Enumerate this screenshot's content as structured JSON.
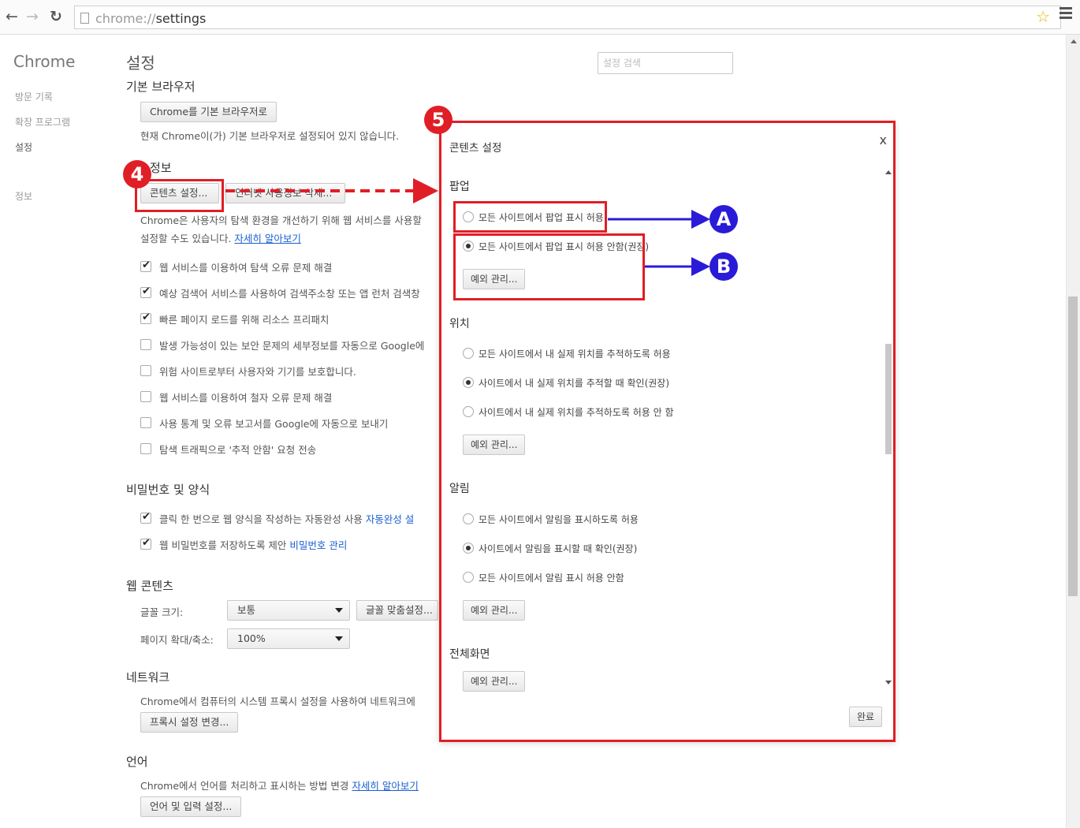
{
  "toolbar": {
    "back_icon": "back-arrow-icon",
    "forward_icon": "forward-arrow-icon",
    "reload_icon": "reload-icon",
    "url_scheme": "chrome://",
    "url_path": "settings",
    "star_icon": "star-icon",
    "menu_icon": "hamburger-menu-icon"
  },
  "sidebar": {
    "brand": "Chrome",
    "items": [
      {
        "label": "방문 기록"
      },
      {
        "label": "확장 프로그램"
      },
      {
        "label": "설정"
      },
      {
        "label": "정보"
      }
    ]
  },
  "settings": {
    "title": "설정",
    "search_placeholder": "설정 검색",
    "default_browser": {
      "heading": "기본 브라우저",
      "button": "Chrome를 기본 브라우저로",
      "status": "현재 Chrome이(가) 기본 브라우저로 설정되어 있지 않습니다."
    },
    "privacy": {
      "heading": "정보",
      "content_settings_button": "콘텐츠 설정...",
      "clear_data_button": "인터넷 사용정보 삭제...",
      "desc_line1": "Chrome은 사용자의 탐색 환경을 개선하기 위해 웹 서비스를 사용할",
      "desc_line2": "설정할 수도 있습니다.",
      "learn_more": "자세히 알아보기",
      "checkboxes": [
        {
          "label": "웹 서비스를 이용하여 탐색 오류 문제 해결",
          "checked": true
        },
        {
          "label": "예상 검색어 서비스를 사용하여 검색주소창 또는 앱 런처 검색창",
          "checked": true
        },
        {
          "label": "빠른 페이지 로드를 위해 리소스 프리패치",
          "checked": true
        },
        {
          "label": "발생 가능성이 있는 보안 문제의 세부정보를 자동으로 Google에",
          "checked": false
        },
        {
          "label": "위험 사이트로부터 사용자와 기기를 보호합니다.",
          "checked": false
        },
        {
          "label": "웹 서비스를 이용하여 철자 오류 문제 해결",
          "checked": false
        },
        {
          "label": "사용 통계 및 오류 보고서를 Google에 자동으로 보내기",
          "checked": false
        },
        {
          "label": "탐색 트래픽으로 '추적 안함' 요청 전송",
          "checked": false
        }
      ]
    },
    "passwords": {
      "heading": "비밀번호 및 양식",
      "autofill_label": "클릭 한 번으로 웹 양식을 작성하는 자동완성 사용",
      "autofill_link": "자동완성 설",
      "password_label": "웹 비밀번호를 저장하도록 제안",
      "password_link": "비밀번호 관리"
    },
    "web_content": {
      "heading": "웹 콘텐츠",
      "font_size_label": "글꼴 크기:",
      "font_size_value": "보통",
      "customize_fonts_button": "글꼴 맞춤설정...",
      "zoom_label": "페이지 확대/축소:",
      "zoom_value": "100%"
    },
    "network": {
      "heading": "네트워크",
      "desc": "Chrome에서 컴퓨터의 시스템 프록시 설정을 사용하여 네트워크에",
      "proxy_button": "프록시 설정 변경..."
    },
    "languages": {
      "heading": "언어",
      "desc": "Chrome에서 언어를 처리하고 표시하는 방법 변경",
      "learn_more": "자세히 알아보기",
      "button": "언어 및 입력 설정..."
    }
  },
  "dialog": {
    "title": "콘텐츠 설정",
    "close": "x",
    "popups": {
      "heading": "팝업",
      "options": [
        {
          "label": "모든 사이트에서 팝업 표시 허용",
          "selected": false
        },
        {
          "label": "모든 사이트에서 팝업 표시 허용 안함(권장)",
          "selected": true
        }
      ],
      "exceptions_button": "예외 관리..."
    },
    "location": {
      "heading": "위치",
      "options": [
        {
          "label": "모든 사이트에서 내 실제 위치를 추적하도록 허용",
          "selected": false
        },
        {
          "label": "사이트에서 내 실제 위치를 추적할 때 확인(권장)",
          "selected": true
        },
        {
          "label": "사이트에서 내 실제 위치를 추적하도록 허용 안 함",
          "selected": false
        }
      ],
      "exceptions_button": "예외 관리..."
    },
    "notifications": {
      "heading": "알림",
      "options": [
        {
          "label": "모든 사이트에서 알림을 표시하도록 허용",
          "selected": false
        },
        {
          "label": "사이트에서 알림을 표시할 때 확인(권장)",
          "selected": true
        },
        {
          "label": "모든 사이트에서 알림 표시 허용 안함",
          "selected": false
        }
      ],
      "exceptions_button": "예외 관리..."
    },
    "fullscreen": {
      "heading": "전체화면",
      "exceptions_button": "예외 관리..."
    },
    "done_button": "완료"
  },
  "annotations": {
    "step4": "4",
    "step5": "5",
    "markerA": "A",
    "markerB": "B",
    "highlight_color": "#e01e26",
    "arrow_blue": "#2a1bd8"
  }
}
